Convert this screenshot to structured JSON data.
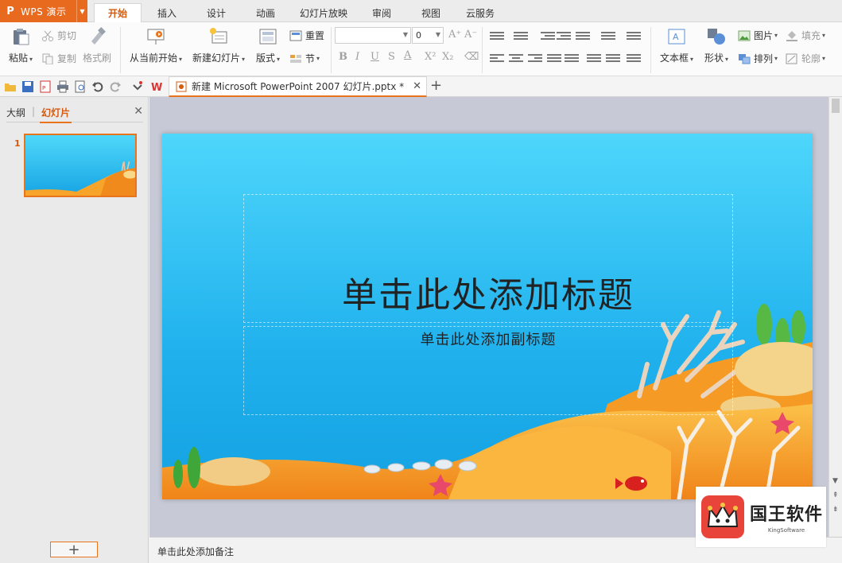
{
  "app": {
    "name": "WPS 演示",
    "logo_glyph": "P",
    "accent": "#e86a1f"
  },
  "menu_tabs": [
    {
      "label": "开始",
      "active": true
    },
    {
      "label": "插入"
    },
    {
      "label": "设计"
    },
    {
      "label": "动画"
    },
    {
      "label": "幻灯片放映"
    },
    {
      "label": "审阅"
    },
    {
      "label": "视图"
    },
    {
      "label": "云服务"
    }
  ],
  "ribbon": {
    "paste": "粘贴",
    "cut": "剪切",
    "copy": "复制",
    "format_painter": "格式刷",
    "from_current": "从当前开始",
    "new_slide": "新建幻灯片",
    "layout": "版式",
    "reset": "重置",
    "section": "节",
    "font_size": "0",
    "bold": "B",
    "italic": "I",
    "underline": "U",
    "strike": "S",
    "font_color": "A",
    "superscript": "X²",
    "subscript": "X₂",
    "grow_font": "A⁺",
    "shrink_font": "A⁻",
    "text_box": "文本框",
    "shape": "形状",
    "picture": "图片",
    "fill": "填充",
    "arrange": "排列",
    "outline": "轮廓"
  },
  "document_tab": {
    "title": "新建 Microsoft PowerPoint 2007 幻灯片.pptx *"
  },
  "left_panel": {
    "tab_outline": "大纲",
    "tab_slides": "幻灯片",
    "slide_number": "1"
  },
  "slide": {
    "title_placeholder": "单击此处添加标题",
    "subtitle_placeholder": "单击此处添加副标题",
    "sky_top": "#48d4f8",
    "sky_bottom": "#1aa8e6",
    "sand": "#f6a020"
  },
  "notes": {
    "placeholder": "单击此处添加备注"
  },
  "watermark": {
    "title": "国王软件",
    "subtitle": "KingSoftware"
  }
}
